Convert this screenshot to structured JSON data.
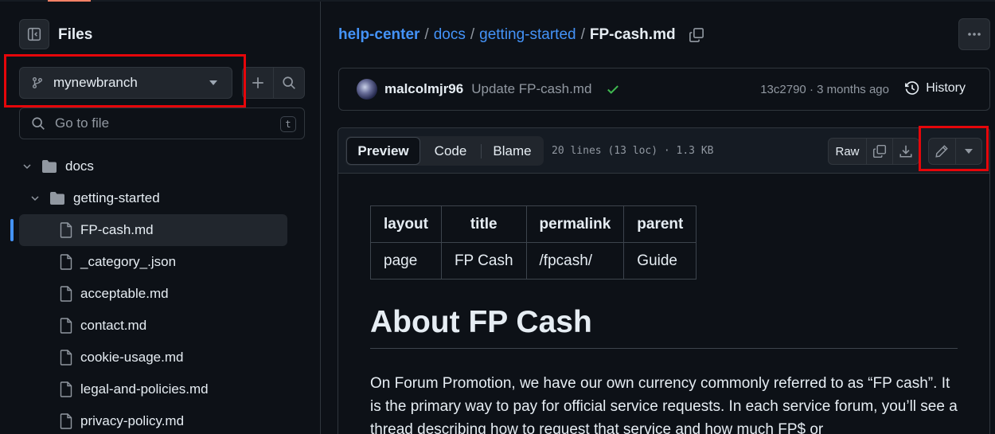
{
  "sidebar": {
    "title": "Files",
    "branch": "mynewbranch",
    "goto_placeholder": "Go to file",
    "goto_shortcut": "t",
    "tree": [
      {
        "label": "docs",
        "type": "folder"
      },
      {
        "label": "getting-started",
        "type": "folder"
      },
      {
        "label": "FP-cash.md",
        "type": "file",
        "selected": true
      },
      {
        "label": "_category_.json",
        "type": "file"
      },
      {
        "label": "acceptable.md",
        "type": "file"
      },
      {
        "label": "contact.md",
        "type": "file"
      },
      {
        "label": "cookie-usage.md",
        "type": "file"
      },
      {
        "label": "legal-and-policies.md",
        "type": "file"
      },
      {
        "label": "privacy-policy.md",
        "type": "file"
      }
    ]
  },
  "breadcrumb": {
    "parts": [
      "help-center",
      "docs",
      "getting-started"
    ],
    "separator": "/",
    "current": "FP-cash.md"
  },
  "commit": {
    "author": "malcolmjr96",
    "message": "Update FP-cash.md",
    "meta": "13c2790 · 3 months ago",
    "history_label": "History"
  },
  "file_header": {
    "tabs": [
      "Preview",
      "Code",
      "Blame"
    ],
    "active_tab": "Preview",
    "info": "20 lines (13 loc) · 1.3 KB",
    "raw_label": "Raw"
  },
  "content": {
    "table": {
      "headers": [
        "layout",
        "title",
        "permalink",
        "parent"
      ],
      "rows": [
        [
          "page",
          "FP Cash",
          "/fpcash/",
          "Guide"
        ]
      ]
    },
    "heading": "About FP Cash",
    "paragraph": "On Forum Promotion, we have our own currency commonly referred to as “FP cash”. It is the primary way to pay for official service requests. In each service forum, you’ll see a thread describing how to request that service and how much FP$ or"
  },
  "colors": {
    "background": "#0d1117",
    "link": "#4493f8",
    "highlight_box": "#e5060a",
    "success": "#3fb950"
  }
}
